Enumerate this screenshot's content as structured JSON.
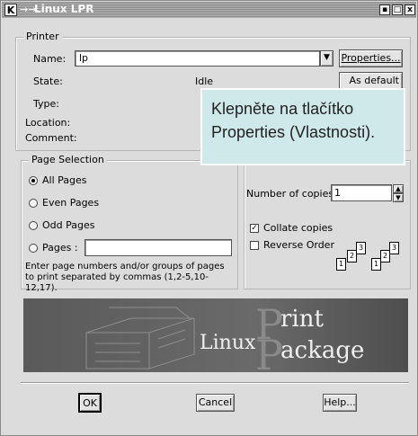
{
  "window": {
    "title": "Linux LPR",
    "title_icon": "K",
    "title_arrows": "→→"
  },
  "titlebar_buttons": {
    "b1": "▪",
    "b2": "□",
    "b3": "x"
  },
  "printer": {
    "group_title": "Printer",
    "name_label": "Name:",
    "name_value": "lp",
    "properties_button": "Properties...",
    "state_label": "State:",
    "state_value": "Idle",
    "set_default_button": "As default",
    "type_label": "Type:",
    "location_label": "Location:",
    "comment_label": "Comment:"
  },
  "tooltip": {
    "text": "Klepněte na tlačítko Properties (Vlastnosti)."
  },
  "page_selection": {
    "group_title": "Page Selection",
    "options": [
      {
        "label": "All Pages",
        "selected": true
      },
      {
        "label": "Even Pages",
        "selected": false
      },
      {
        "label": "Odd Pages",
        "selected": false
      },
      {
        "label": "Pages :",
        "selected": false
      }
    ],
    "pages_value": "",
    "hint": "Enter page numbers and/or groups of pages to print separated by commas (1,2-5,10-12,17)."
  },
  "copies": {
    "group_title_partial": "C",
    "number_label": "Number of copies:",
    "number_value": "1",
    "collate_label": "Collate copies",
    "collate_checked": true,
    "reverse_label": "Reverse Order",
    "reverse_checked": false,
    "page_numbers": [
      "1",
      "2",
      "3"
    ]
  },
  "banner": {
    "word1": "Linux",
    "word2_letter": "P",
    "word2_rest": "rint",
    "word3_letter": "P",
    "word3_rest": "ackage"
  },
  "footer": {
    "ok_button": "OK",
    "cancel_button": "Cancel",
    "help_button": "Help..."
  }
}
